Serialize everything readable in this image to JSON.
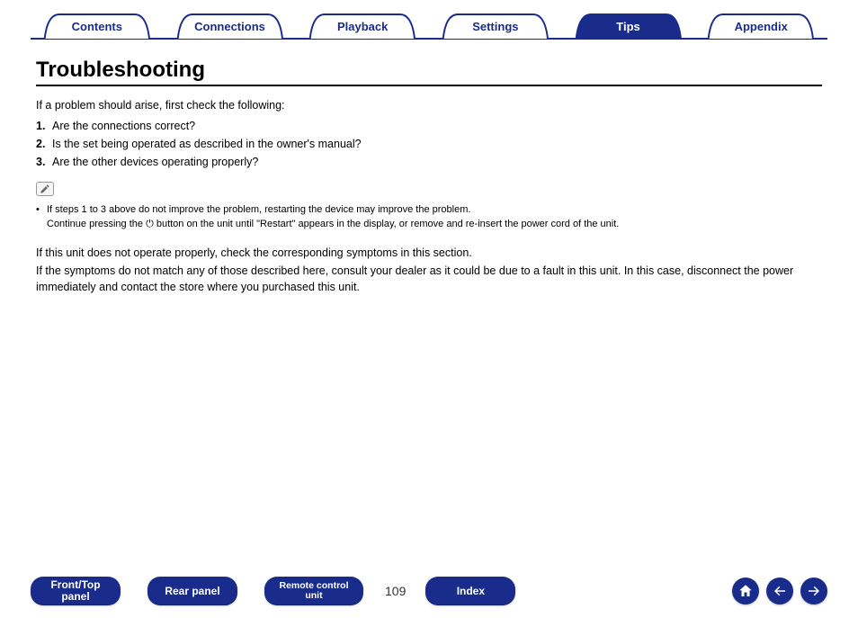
{
  "tabs": {
    "items": [
      {
        "label": "Contents",
        "active": false
      },
      {
        "label": "Connections",
        "active": false
      },
      {
        "label": "Playback",
        "active": false
      },
      {
        "label": "Settings",
        "active": false
      },
      {
        "label": "Tips",
        "active": true
      },
      {
        "label": "Appendix",
        "active": false
      }
    ]
  },
  "title": "Troubleshooting",
  "intro": "If a problem should arise, first check the following:",
  "checks": [
    "Are the connections correct?",
    "Is the set being operated as described in the owner's manual?",
    "Are the other devices operating properly?"
  ],
  "note": {
    "line1": "If steps 1 to 3 above do not improve the problem, restarting the device may improve the problem.",
    "line2a": "Continue pressing the ",
    "line2b": " button on the unit until \"Restart\" appears in the display, or remove and re-insert the power cord of the unit."
  },
  "para1": "If this unit does not operate properly, check the corresponding symptoms in this section.",
  "para2": "If the symptoms do not match any of those described here, consult your dealer as it could be due to a fault in this unit. In this case, disconnect the power immediately and contact the store where you purchased this unit.",
  "bottom": {
    "front_top": "Front/Top\npanel",
    "rear": "Rear panel",
    "remote": "Remote control\nunit",
    "index": "Index",
    "page": "109"
  },
  "colors": {
    "brand": "#1a2c8b"
  }
}
